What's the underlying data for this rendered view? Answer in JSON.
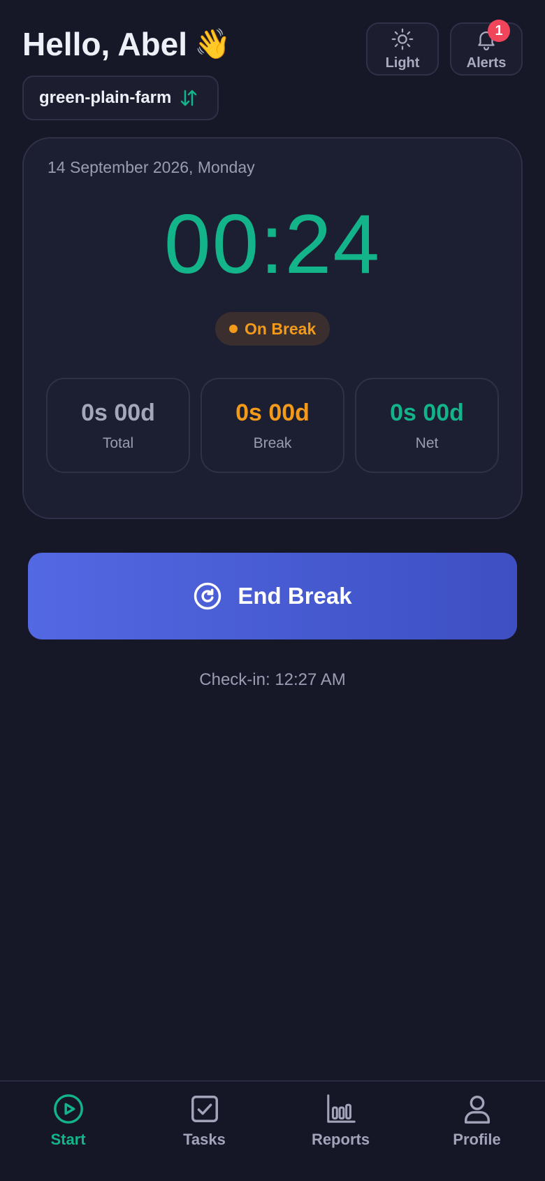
{
  "header": {
    "greeting": "Hello, Abel",
    "wave_emoji": "👋",
    "theme_button": {
      "label": "Light",
      "icon": "sun-icon"
    },
    "alerts_button": {
      "label": "Alerts",
      "icon": "bell-icon",
      "badge_count": "1"
    },
    "farm": {
      "name": "green-plain-farm",
      "icon": "swap-vertical-icon"
    }
  },
  "session": {
    "date": "14 September 2026, Monday",
    "timer": "00:24",
    "status": "On Break",
    "stats": [
      {
        "value": "0s 00d",
        "label": "Total"
      },
      {
        "value": "0s 00d",
        "label": "Break"
      },
      {
        "value": "0s 00d",
        "label": "Net"
      }
    ]
  },
  "action": {
    "label": "End Break",
    "icon": "refresh-circle-icon"
  },
  "checkin_text": "Check-in: 12:27 AM",
  "nav": [
    {
      "label": "Start",
      "icon": "play-circle-icon",
      "active": true
    },
    {
      "label": "Tasks",
      "icon": "checkbox-icon",
      "active": false
    },
    {
      "label": "Reports",
      "icon": "bar-chart-icon",
      "active": false
    },
    {
      "label": "Profile",
      "icon": "user-icon",
      "active": false
    }
  ],
  "colors": {
    "background": "#161828",
    "accent_green": "#14b48a",
    "accent_orange": "#f39a1a",
    "primary_blue": "#4b5fd6",
    "badge_red": "#f0455a",
    "muted_text": "#9a9db2"
  }
}
